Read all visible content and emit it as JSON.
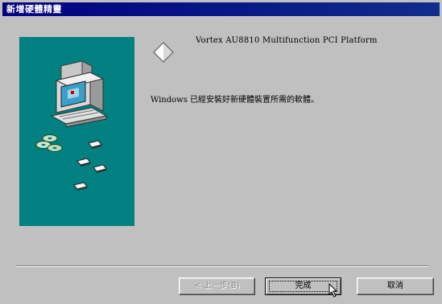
{
  "window": {
    "title": "新增硬體精靈"
  },
  "content": {
    "device_name": "Vortex AU8810 Multifunction PCI Platform",
    "message": "Windows 已經安裝好新硬體裝置所需的軟體。"
  },
  "buttons": {
    "back_label": "< 上一步(B)",
    "finish_label": "完成",
    "cancel_label": "取消"
  },
  "icons": {
    "device": "diamond-icon",
    "art": "computer-with-cds-icon",
    "pointer": "mouse-cursor-icon"
  },
  "colors": {
    "title_bar": "#000080",
    "dialog": "#c0c0c0",
    "art_background": "#008080"
  }
}
